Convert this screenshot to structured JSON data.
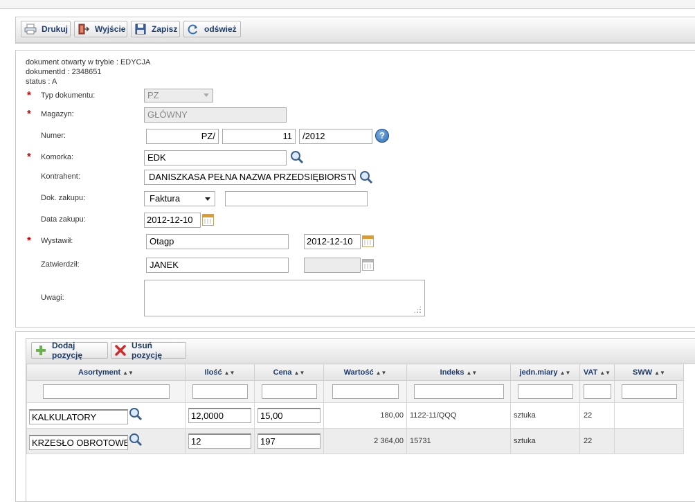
{
  "toolbar": {
    "print": "Drukuj",
    "exit": "Wyjście",
    "save": "Zapisz",
    "refresh": "odśwież"
  },
  "info": {
    "mode": "dokument otwarty w trybie : EDYCJA",
    "doc_id": "dokumentId : 2348651",
    "status": "status : A"
  },
  "form": {
    "typ_label": "Typ dokumentu:",
    "typ_value": "PZ",
    "magazyn_label": "Magazyn:",
    "magazyn_value": "GŁÓWNY",
    "numer_label": "Numer:",
    "numer_prefix": "PZ/",
    "numer_value": "11",
    "numer_suffix": "/2012",
    "komorka_label": "Komorka:",
    "komorka_value": "EDK",
    "kontrahent_label": "Kontrahent:",
    "kontrahent_value": "DANISZKASA PEŁNA NAZWA PRZEDSIĘBIORSTWA",
    "dok_label": "Dok. zakupu:",
    "dok_select": "Faktura",
    "dok_number": "",
    "data_label": "Data zakupu:",
    "data_value": "2012-12-10",
    "wystawil_label": "Wystawił:",
    "wystawil_value": "Otagp",
    "wystawil_date": "2012-12-10",
    "zatwierdzil_label": "Zatwierdził:",
    "zatwierdzil_value": "JANEK",
    "zatwierdzil_date": "",
    "uwagi_label": "Uwagi:",
    "uwagi_value": ""
  },
  "grid_toolbar": {
    "add": "Dodaj pozycję",
    "remove": "Usuń pozycję"
  },
  "grid": {
    "columns": [
      "Asortyment",
      "Ilość",
      "Cena",
      "Wartość",
      "Indeks",
      "jedn.miary",
      "VAT",
      "SWW"
    ],
    "rows": [
      {
        "asortyment": "KALKULATORY",
        "ilosc": "12,0000",
        "cena": "15,00",
        "wartosc": "180,00",
        "indeks": "1122-11/QQQ",
        "jm": "sztuka",
        "vat": "22",
        "sww": ""
      },
      {
        "asortyment": "KRZESŁO OBROTOWE",
        "ilosc": "12",
        "cena": "197",
        "wartosc": "2 364,00",
        "indeks": "15731",
        "jm": "sztuka",
        "vat": "22",
        "sww": ""
      }
    ]
  },
  "colors": {
    "required": "#cc0000",
    "button_text": "#1d3b6b",
    "help": "#2f6db5"
  }
}
